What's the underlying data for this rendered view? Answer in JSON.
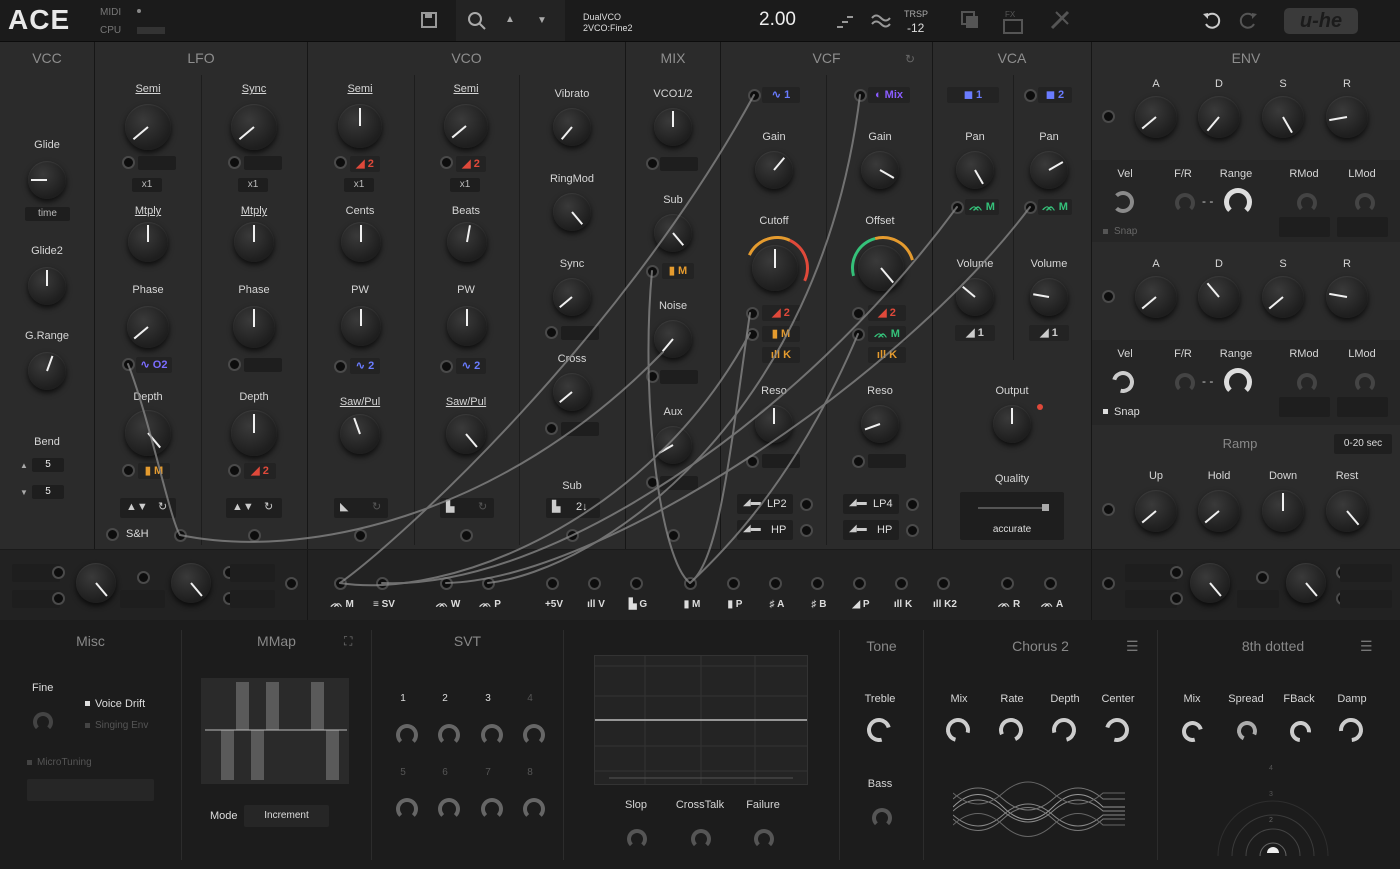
{
  "topbar": {
    "logo": "ACE",
    "midi_label": "MIDI",
    "cpu_label": "CPU",
    "preset_line1": "DualVCO",
    "preset_line2": "2VCO:Fine2",
    "value": "2.00",
    "trsp_label": "TRSP",
    "trsp_value": "-12",
    "fx_label": "FX",
    "brand": "u-he"
  },
  "sections": {
    "vcc": "VCC",
    "lfo": "LFO",
    "vco": "VCO",
    "mix": "MIX",
    "vcf": "VCF",
    "vca": "VCA",
    "env": "ENV"
  },
  "vcc": {
    "glide": "Glide",
    "time": "time",
    "glide2": "Glide2",
    "grange": "G.Range",
    "bend": "Bend",
    "bend_up": "5",
    "bend_down": "5"
  },
  "lfo": {
    "semi": "Semi",
    "sync": "Sync",
    "x1a": "x1",
    "x1b": "x1",
    "mtply1": "Mtply",
    "mtply2": "Mtply",
    "phase1": "Phase",
    "phase2": "Phase",
    "mod_o2": "O2",
    "depth1": "Depth",
    "depth2": "Depth",
    "mod_m": "M",
    "mod_2": "2",
    "sh": "S&H"
  },
  "vco": {
    "semi1": "Semi",
    "semi2": "Semi",
    "mod1": "2",
    "mod2": "2",
    "x1a": "x1",
    "x1b": "x1",
    "cents": "Cents",
    "beats": "Beats",
    "pw1": "PW",
    "pw2": "PW",
    "pwm1": "2",
    "pwm2": "2",
    "sawpul1": "Saw/Pul",
    "sawpul2": "Saw/Pul",
    "vibrato": "Vibrato",
    "ringmod": "RingMod",
    "sync": "Sync",
    "cross": "Cross",
    "sub": "Sub",
    "sub_val": "2↓"
  },
  "mix": {
    "vco12": "VCO1/2",
    "sub": "Sub",
    "sub_mod": "M",
    "noise": "Noise",
    "aux": "Aux"
  },
  "vcf": {
    "in1": "1",
    "in2": "Mix",
    "gain1": "Gain",
    "gain2": "Gain",
    "cutoff": "Cutoff",
    "offset": "Offset",
    "m1": "2",
    "m2": "M",
    "m3": "K",
    "m4": "2",
    "m5": "M",
    "m6": "K",
    "reso1": "Reso",
    "reso2": "Reso",
    "lp2": "LP2",
    "hp1": "HP",
    "lp4": "LP4",
    "hp2": "HP"
  },
  "vca": {
    "in1": "1",
    "in2": "2",
    "pan1": "Pan",
    "pan2": "Pan",
    "panmod1": "M",
    "panmod2": "M",
    "vol1": "Volume",
    "vol2": "Volume",
    "volmod1": "1",
    "volmod2": "1",
    "output": "Output",
    "quality": "Quality",
    "quality_val": "accurate"
  },
  "env": {
    "a": "A",
    "d": "D",
    "s": "S",
    "r": "R",
    "vel": "Vel",
    "fr": "F/R",
    "range": "Range",
    "rmod": "RMod",
    "lmod": "LMod",
    "snap": "Snap",
    "ramp": "Ramp",
    "ramp_range": "0-20 sec",
    "up": "Up",
    "hold": "Hold",
    "down": "Down",
    "rest": "Rest"
  },
  "patchbay": [
    "M",
    "SV",
    "W",
    "P",
    "+5V",
    "V",
    "G",
    "M",
    "P",
    "A",
    "B",
    "P",
    "K",
    "K2",
    "R",
    "A"
  ],
  "bottom": {
    "misc": "Misc",
    "fine": "Fine",
    "voice_drift": "Voice Drift",
    "singing_env": "Singing Env",
    "microtuning": "MicroTuning",
    "mmap": "MMap",
    "mode": "Mode",
    "mode_val": "Increment",
    "svt": "SVT",
    "svt_nums": [
      "1",
      "2",
      "3",
      "4",
      "5",
      "6",
      "7",
      "8"
    ],
    "slop": "Slop",
    "crosstalk": "CrossTalk",
    "failure": "Failure",
    "tone": "Tone",
    "treble": "Treble",
    "bass": "Bass",
    "chorus": "Chorus 2",
    "c_mix": "Mix",
    "c_rate": "Rate",
    "c_depth": "Depth",
    "c_center": "Center",
    "delay": "8th dotted",
    "d_mix": "Mix",
    "d_spread": "Spread",
    "d_fback": "FBack",
    "d_damp": "Damp",
    "delay_marks": [
      "4",
      "3",
      "2"
    ]
  },
  "colors": {
    "accent_red": "#e0493a",
    "accent_blue": "#6a7cff",
    "accent_orange": "#e59b2e",
    "accent_green": "#35c27a",
    "accent_purple": "#8a5cff"
  }
}
